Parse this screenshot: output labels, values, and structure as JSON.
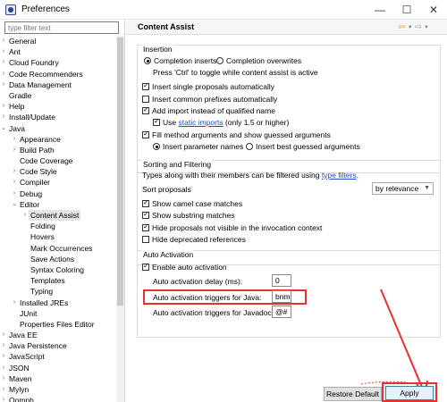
{
  "window": {
    "title": "Preferences",
    "controls": [
      "—",
      "☐",
      "✕"
    ]
  },
  "filter": {
    "placeholder": "type filter text"
  },
  "tree": [
    {
      "label": "General",
      "expanded": false,
      "level": 0
    },
    {
      "label": "Ant",
      "expanded": false,
      "level": 0
    },
    {
      "label": "Cloud Foundry",
      "expanded": false,
      "level": 0
    },
    {
      "label": "Code Recommenders",
      "expanded": false,
      "level": 0
    },
    {
      "label": "Data Management",
      "expanded": false,
      "level": 0
    },
    {
      "label": "Gradle",
      "expanded": null,
      "level": 0
    },
    {
      "label": "Help",
      "expanded": false,
      "level": 0
    },
    {
      "label": "Install/Update",
      "expanded": false,
      "level": 0
    },
    {
      "label": "Java",
      "expanded": true,
      "level": 0
    },
    {
      "label": "Appearance",
      "expanded": false,
      "level": 1
    },
    {
      "label": "Build Path",
      "expanded": false,
      "level": 1
    },
    {
      "label": "Code Coverage",
      "expanded": null,
      "level": 1
    },
    {
      "label": "Code Style",
      "expanded": false,
      "level": 1
    },
    {
      "label": "Compiler",
      "expanded": false,
      "level": 1
    },
    {
      "label": "Debug",
      "expanded": false,
      "level": 1
    },
    {
      "label": "Editor",
      "expanded": true,
      "level": 1
    },
    {
      "label": "Content Assist",
      "expanded": false,
      "level": 2,
      "selected": true
    },
    {
      "label": "Folding",
      "expanded": null,
      "level": 2
    },
    {
      "label": "Hovers",
      "expanded": null,
      "level": 2
    },
    {
      "label": "Mark Occurrences",
      "expanded": null,
      "level": 2
    },
    {
      "label": "Save Actions",
      "expanded": null,
      "level": 2
    },
    {
      "label": "Syntax Coloring",
      "expanded": null,
      "level": 2
    },
    {
      "label": "Templates",
      "expanded": null,
      "level": 2
    },
    {
      "label": "Typing",
      "expanded": null,
      "level": 2
    },
    {
      "label": "Installed JREs",
      "expanded": false,
      "level": 1
    },
    {
      "label": "JUnit",
      "expanded": null,
      "level": 1
    },
    {
      "label": "Properties Files Editor",
      "expanded": null,
      "level": 1
    },
    {
      "label": "Java EE",
      "expanded": false,
      "level": 0
    },
    {
      "label": "Java Persistence",
      "expanded": false,
      "level": 0
    },
    {
      "label": "JavaScript",
      "expanded": false,
      "level": 0
    },
    {
      "label": "JSON",
      "expanded": false,
      "level": 0
    },
    {
      "label": "Maven",
      "expanded": false,
      "level": 0
    },
    {
      "label": "Mylyn",
      "expanded": false,
      "level": 0
    },
    {
      "label": "Oomph",
      "expanded": false,
      "level": 0
    }
  ],
  "page": {
    "title": "Content Assist",
    "nav_back": "⇦",
    "nav_forward": "⇨",
    "nav_dropdown": "▼"
  },
  "insertion": {
    "title": "Insertion",
    "completion_inserts": "Completion inserts",
    "completion_overwrites": "Completion overwrites",
    "toggle_hint": "Press 'Ctrl' to toggle while content assist is active",
    "insert_single": "Insert single proposals automatically",
    "insert_common_prefixes": "Insert common prefixes automatically",
    "add_import": "Add import instead of qualified name",
    "use_label": "Use",
    "static_imports_link": "static imports",
    "static_imports_suffix": "(only 1.5 or higher)",
    "fill_method": "Fill method arguments and show guessed arguments",
    "insert_param_names": "Insert parameter names",
    "insert_best_guessed": "Insert best guessed arguments"
  },
  "sorting": {
    "title": "Sorting and Filtering",
    "types_prefix": "Types along with their members can be filtered using",
    "type_filters_link": "type filters",
    "types_suffix": ".",
    "sort_proposals": "Sort proposals",
    "sort_value": "by relevance",
    "show_camel": "Show camel case matches",
    "show_substring": "Show substring matches",
    "hide_not_visible": "Hide proposals not visible in the invocation context",
    "hide_deprecated": "Hide deprecated references"
  },
  "auto_activation": {
    "title": "Auto Activation",
    "enable": "Enable auto activation",
    "delay_label": "Auto activation delay (ms):",
    "delay_value": "0",
    "java_triggers_label": "Auto activation triggers for Java:",
    "java_triggers_value": "bnm",
    "javadoc_triggers_label": "Auto activation triggers for Javadoc:",
    "javadoc_triggers_value": "@#"
  },
  "buttons": {
    "restore_default": "Restore Default",
    "apply": "Apply"
  },
  "colors": {
    "highlight": "#e8312f",
    "link": "#1a4ec9",
    "nav_back": "#d89a15"
  }
}
